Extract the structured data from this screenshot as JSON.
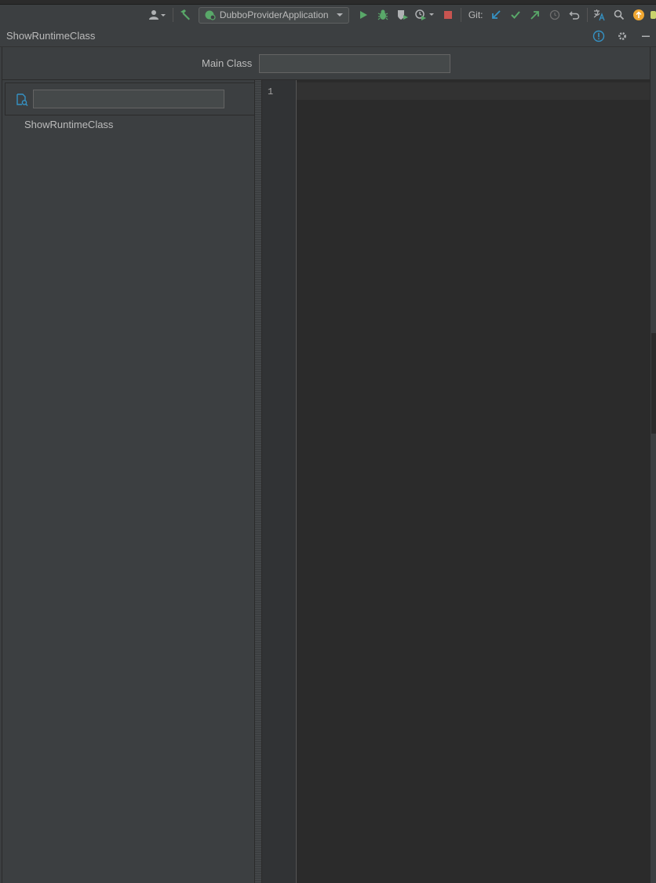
{
  "toolbar": {
    "run_config_label": "DubboProviderApplication",
    "git_label": "Git:"
  },
  "tool_window": {
    "title": "ShowRuntimeClass"
  },
  "form": {
    "main_class_label": "Main Class",
    "main_class_value": ""
  },
  "class_search": {
    "value": ""
  },
  "tree": {
    "items": [
      "ShowRuntimeClass"
    ]
  },
  "editor": {
    "line_numbers": [
      "1"
    ]
  },
  "colors": {
    "accent_green": "#59a869",
    "accent_blue": "#3592c4",
    "stop_red": "#c75450",
    "update_orange": "#f0a732"
  }
}
